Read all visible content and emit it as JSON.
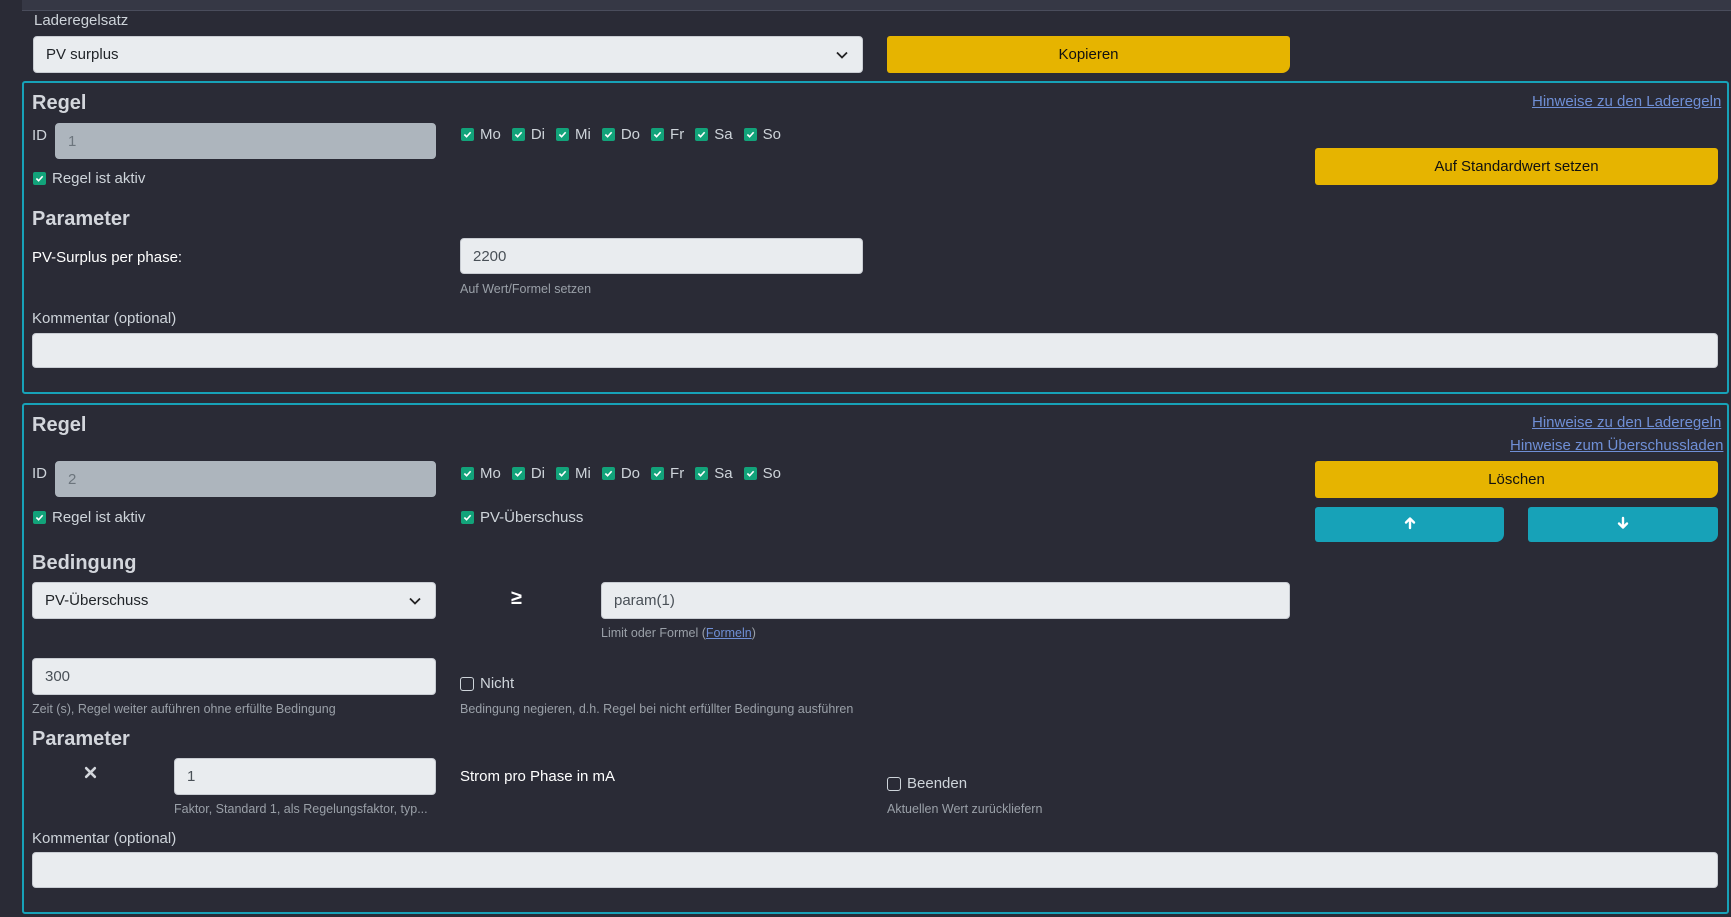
{
  "header": {
    "ruleset_label": "Laderegelsatz",
    "ruleset_value": "PV surplus",
    "copy_button": "Kopieren"
  },
  "rule1": {
    "title": "Regel",
    "hint_link": "Hinweise zu den Laderegeln",
    "id_label": "ID",
    "id_value": "1",
    "days": [
      "Mo",
      "Di",
      "Mi",
      "Do",
      "Fr",
      "Sa",
      "So"
    ],
    "active_label": "Regel ist aktiv",
    "reset_button": "Auf Standardwert setzen",
    "params_title": "Parameter",
    "param_label": "PV-Surplus per phase:",
    "param_value": "2200",
    "param_hint": "Auf Wert/Formel setzen",
    "comment_label": "Kommentar (optional)",
    "comment_value": ""
  },
  "rule2": {
    "title": "Regel",
    "hint_link_1": "Hinweise zu den Laderegeln",
    "hint_link_2": "Hinweise zum Überschussladen",
    "id_label": "ID",
    "id_value": "2",
    "days": [
      "Mo",
      "Di",
      "Mi",
      "Do",
      "Fr",
      "Sa",
      "So"
    ],
    "active_label": "Regel ist aktiv",
    "pv_surplus_label": "PV-Überschuss",
    "delete_button": "Löschen",
    "condition_title": "Bedingung",
    "condition_select": "PV-Überschuss",
    "operator": "≥",
    "limit_value": "param(1)",
    "limit_hint_prefix": "Limit oder Formel (",
    "limit_hint_link": "Formeln",
    "limit_hint_suffix": ")",
    "time_value": "300",
    "time_hint": "Zeit (s), Regel weiter auführen ohne erfüllte Bedingung",
    "not_label": "Nicht",
    "not_hint": "Bedingung negieren, d.h. Regel bei nicht erfüllter Bedingung ausführen",
    "params_title": "Parameter",
    "factor_value": "1",
    "factor_hint": "Faktor, Standard 1, als Regelungsfaktor, typ...",
    "current_label": "Strom pro Phase in mA",
    "end_label": "Beenden",
    "end_hint": "Aktuellen Wert zurückliefern",
    "comment_label": "Kommentar (optional)",
    "comment_value": ""
  }
}
